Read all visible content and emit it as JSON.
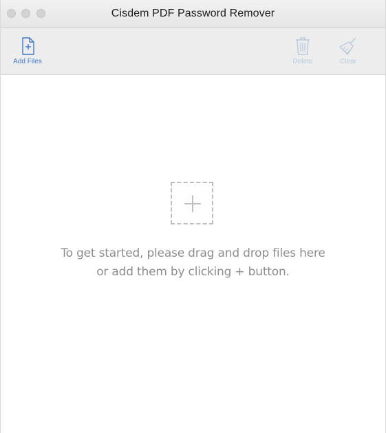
{
  "window": {
    "title": "Cisdem PDF Password Remover"
  },
  "toolbar": {
    "add_files_label": "Add Files",
    "delete_label": "Delete",
    "clear_label": "Clear"
  },
  "drop_zone": {
    "line1": "To get started, please drag and drop files here",
    "line2": "or add them by clicking + button."
  },
  "icons": {
    "add_files": "document-plus-icon",
    "delete": "trash-icon",
    "clear": "broom-icon",
    "drop": "plus-icon"
  },
  "colors": {
    "accent": "#3d79c6",
    "disabled": "#b9c9de",
    "hint_text": "#8e8e8e"
  }
}
